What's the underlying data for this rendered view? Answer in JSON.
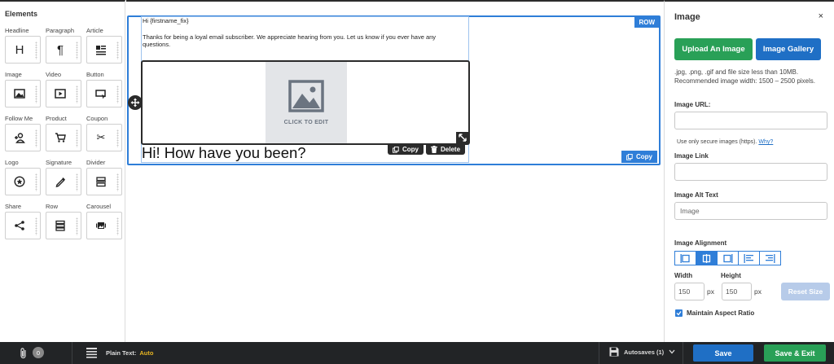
{
  "elements_panel": {
    "title": "Elements",
    "items": [
      {
        "label": "Headline",
        "icon": "headline-icon"
      },
      {
        "label": "Paragraph",
        "icon": "paragraph-icon"
      },
      {
        "label": "Article",
        "icon": "article-icon"
      },
      {
        "label": "Image",
        "icon": "image-icon"
      },
      {
        "label": "Video",
        "icon": "video-icon"
      },
      {
        "label": "Button",
        "icon": "button-icon"
      },
      {
        "label": "Follow Me",
        "icon": "follow-me-icon"
      },
      {
        "label": "Product",
        "icon": "cart-icon"
      },
      {
        "label": "Coupon",
        "icon": "scissors-icon"
      },
      {
        "label": "Logo",
        "icon": "logo-star-icon"
      },
      {
        "label": "Signature",
        "icon": "pen-icon"
      },
      {
        "label": "Divider",
        "icon": "divider-icon"
      },
      {
        "label": "Share",
        "icon": "share-icon"
      },
      {
        "label": "Row",
        "icon": "row-icon"
      },
      {
        "label": "Carousel",
        "icon": "carousel-icon"
      }
    ]
  },
  "canvas": {
    "row_badge": "ROW",
    "row_copy_label": "Copy",
    "greeting": "Hi {firstname_fix}",
    "intro": "Thanks for being a loyal email subscriber. We appreciate hearing from you. Let us know if you ever have any questions.",
    "image_placeholder_text": "CLICK TO EDIT",
    "image_copy_label": "Copy",
    "image_delete_label": "Delete",
    "headline": "Hi! How have you been?"
  },
  "image_panel": {
    "title": "Image",
    "close": "×",
    "upload_button": "Upload An Image",
    "gallery_button": "Image Gallery",
    "help_text": ".jpg, .png, .gif and file size less than 10MB. Recommended image width: 1500 – 2500 pixels.",
    "url_label": "Image URL:",
    "url_value": "",
    "secure_note": "Use only secure images (https).",
    "secure_link": "Why?",
    "link_label": "Image Link",
    "link_value": "",
    "alt_label": "Image Alt Text",
    "alt_value": "Image",
    "alignment_label": "Image Alignment",
    "width_label": "Width",
    "width_value": "150",
    "width_unit": "px",
    "height_label": "Height",
    "height_value": "150",
    "height_unit": "px",
    "reset_button": "Reset Size",
    "aspect_label": "Maintain Aspect Ratio",
    "aspect_checked": true
  },
  "bottom_bar": {
    "attachments_count": "0",
    "plain_text_label": "Plain Text:",
    "plain_text_value": "Auto",
    "autosaves_label": "Autosaves (1)",
    "save_button": "Save",
    "save_exit_button": "Save & Exit"
  },
  "colors": {
    "accent_blue": "#2f7ed8",
    "brand_green": "#29a057",
    "button_blue": "#1f6fc5",
    "auto_yellow": "#e6b422"
  }
}
